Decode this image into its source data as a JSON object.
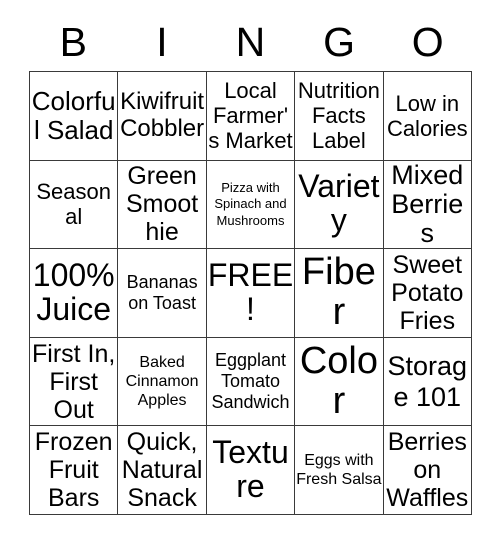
{
  "card": {
    "background_color": "#ffffff",
    "text_color": "#000000",
    "border_color": "#3a3a3a",
    "free_space_label": "FREE!"
  },
  "header": {
    "letters": [
      {
        "label": "B"
      },
      {
        "label": "I"
      },
      {
        "label": "N"
      },
      {
        "label": "G"
      },
      {
        "label": "O"
      }
    ]
  },
  "grid": {
    "columns": 5,
    "rows": 5,
    "cells": [
      {
        "text": "Colorful Salad",
        "size": "lg",
        "free": false
      },
      {
        "text": "Kiwifruit Cobbler",
        "size": "lg",
        "free": false
      },
      {
        "text": "Local Farmer's Market",
        "size": "md",
        "free": false
      },
      {
        "text": "Nutrition Facts Label",
        "size": "md",
        "free": false
      },
      {
        "text": "Low in Calories",
        "size": "md",
        "free": false
      },
      {
        "text": "Seasonal",
        "size": "md",
        "free": false
      },
      {
        "text": "Green Smoothie",
        "size": "lg",
        "free": false
      },
      {
        "text": "Pizza with Spinach and Mushrooms",
        "size": "xxs",
        "free": false
      },
      {
        "text": "Variety",
        "size": "xl",
        "free": false
      },
      {
        "text": "Mixed Berries",
        "size": "xl",
        "free": false
      },
      {
        "text": "100% Juice",
        "size": "xl",
        "free": false
      },
      {
        "text": "Bananas on Toast",
        "size": "sm",
        "free": false
      },
      {
        "text": "FREE!",
        "size": "xl",
        "free": true
      },
      {
        "text": "Fiber",
        "size": "xxl",
        "free": false
      },
      {
        "text": "Sweet Potato Fries",
        "size": "lg",
        "free": false
      },
      {
        "text": "First In, First Out",
        "size": "lg",
        "free": false
      },
      {
        "text": "Baked Cinnamon Apples",
        "size": "xs",
        "free": false
      },
      {
        "text": "Eggplant Tomato Sandwich",
        "size": "sm",
        "free": false
      },
      {
        "text": "Color",
        "size": "xxl",
        "free": false
      },
      {
        "text": "Storage 101",
        "size": "lg",
        "free": false
      },
      {
        "text": "Frozen Fruit Bars",
        "size": "lg",
        "free": false
      },
      {
        "text": "Quick, Natural Snack",
        "size": "lg",
        "free": false
      },
      {
        "text": "Texture",
        "size": "xl",
        "free": false
      },
      {
        "text": "Eggs with Fresh Salsa",
        "size": "xs",
        "free": false
      },
      {
        "text": "Berries on Waffles",
        "size": "lg",
        "free": false
      }
    ]
  }
}
